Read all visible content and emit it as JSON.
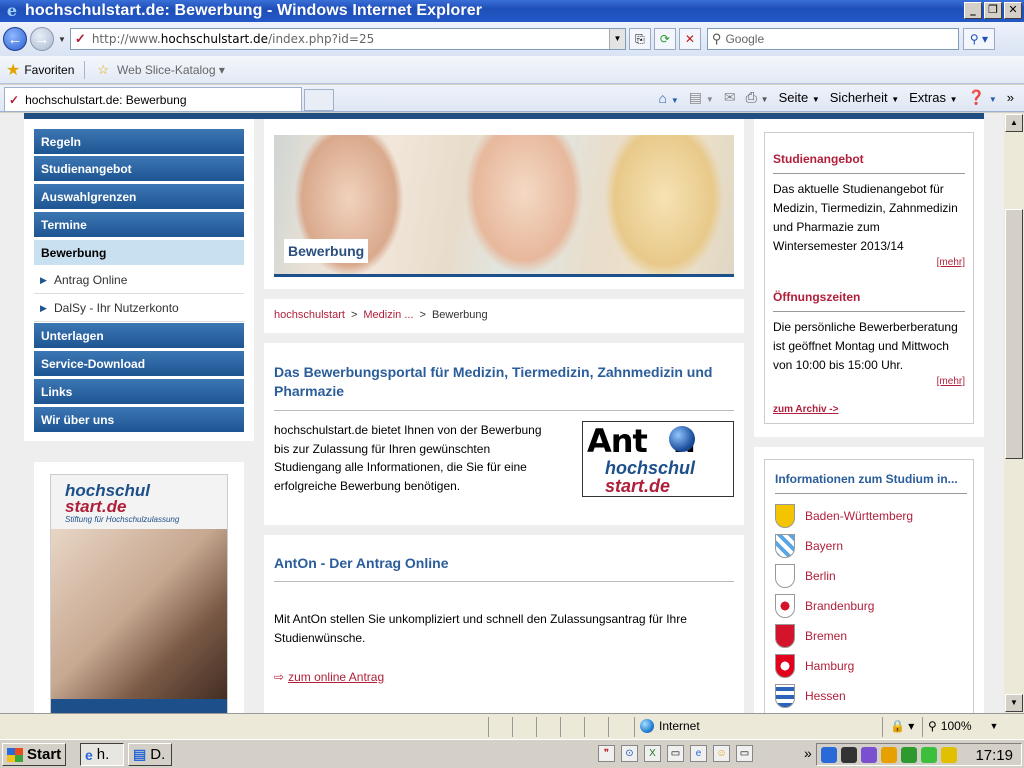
{
  "window": {
    "title": "hochschulstart.de: Bewerbung - Windows Internet Explorer",
    "min": "_",
    "max": "❐",
    "close": "✕"
  },
  "address": {
    "url_prefix": "http://www.",
    "url_domain": "hochschulstart.de",
    "url_suffix": "/index.php?id=25",
    "search_placeholder": "Google"
  },
  "favorites": {
    "label": "Favoriten",
    "web_slice": "Web Slice-Katalog"
  },
  "tabs": [
    {
      "label": "hochschulstart.de: Bewerbung"
    }
  ],
  "commands": {
    "page": "Seite",
    "safety": "Sicherheit",
    "tools": "Extras"
  },
  "sidebar": {
    "items": [
      {
        "label": "Regeln"
      },
      {
        "label": "Studienangebot"
      },
      {
        "label": "Auswahlgrenzen"
      },
      {
        "label": "Termine"
      },
      {
        "label": "Bewerbung"
      },
      {
        "label": "Antrag Online"
      },
      {
        "label": "DalSy - Ihr Nutzerkonto"
      },
      {
        "label": "Unterlagen"
      },
      {
        "label": "Service-Download"
      },
      {
        "label": "Links"
      },
      {
        "label": "Wir über uns"
      }
    ],
    "magazine": {
      "logo_line1": "hochschul",
      "logo_line2": "start.de",
      "tagline": "Stiftung für Hochschulzulassung"
    }
  },
  "main": {
    "hero_caption": "Bewerbung",
    "breadcrumb": [
      {
        "label": "hochschulstart"
      },
      {
        "label": "Medizin ..."
      },
      {
        "label": "Bewerbung"
      }
    ],
    "breadcrumb_sep": ">",
    "portal": {
      "heading": "Das Bewerbungsportal für Medizin, Tiermedizin, Zahnmedizin und Pharmazie",
      "text_line1": "hochschulstart.de bietet Ihnen von der Bewerbung",
      "text_line2": "bis zur Zulassung für Ihren gewünschten",
      "text_line3": "Studiengang alle Informationen, die Sie für eine",
      "text_line4": "erfolgreiche Bewerbung benötigen.",
      "logo_word": "Ant",
      "logo_word_end": "n",
      "logo_line2": "hochschul",
      "logo_line3": "start.de"
    },
    "anton": {
      "heading": "AntOn - Der Antrag Online",
      "text_line1": "Mit AntOn stellen Sie unkompliziert  und schnell den Zulassungsantrag für Ihre",
      "text_line2": "Studienwünsche.",
      "link": "zum online Antrag"
    }
  },
  "right": {
    "studienangebot": {
      "heading": "Studienangebot",
      "line1": "Das aktuelle Studienangebot für",
      "line2": "Medizin, Tiermedizin, Zahnmedizin",
      "line3": "und Pharmazie zum",
      "line4": "Wintersemester 2013/14",
      "more": "[mehr]"
    },
    "hours": {
      "heading": "Öffnungszeiten",
      "line1": "Die persönliche Bewerberberatung",
      "line2": "ist geöffnet Montag und Mittwoch",
      "line3": "von 10:00 bis 15:00 Uhr.",
      "more": "[mehr]"
    },
    "archive": "zum Archiv ->",
    "states": {
      "heading": "Informationen zum Studium in...",
      "items": [
        {
          "name": "Baden-Württemberg",
          "color": "#f2c500"
        },
        {
          "name": "Bayern",
          "color": "#5aa5e6"
        },
        {
          "name": "Berlin",
          "color": "#ffffff"
        },
        {
          "name": "Brandenburg",
          "color": "#e8e8e8"
        },
        {
          "name": "Bremen",
          "color": "#d4142a"
        },
        {
          "name": "Hamburg",
          "color": "#e2001a"
        },
        {
          "name": "Hessen",
          "color": "#2a63b8"
        }
      ]
    }
  },
  "statusbar": {
    "zone": "Internet",
    "zoom": "100%"
  },
  "taskbar": {
    "start": "Start",
    "item1": "h.",
    "item2": "D.",
    "clock": "17:19"
  },
  "colors": {
    "brand_red": "#b01f3a",
    "brand_blue": "#1d4f8a",
    "nav_blue": "#2a5d9a"
  }
}
